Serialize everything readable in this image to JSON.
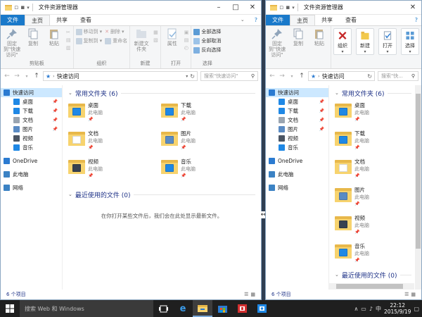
{
  "left": {
    "title": "文件资源管理器",
    "tabs": [
      "文件",
      "主页",
      "共享",
      "查看"
    ],
    "ribbon": {
      "clipboard": {
        "label": "剪贴板",
        "pin": "固定到\"快速访问\"",
        "copy": "复制",
        "paste": "粘贴"
      },
      "organize": {
        "label": "组织",
        "move": "移动到",
        "copy_to": "复制到",
        "delete": "删除",
        "rename": "重命名"
      },
      "new": {
        "label": "新建",
        "folder": "新建文件夹"
      },
      "open": {
        "label": "打开",
        "properties": "属性"
      },
      "select": {
        "label": "选择",
        "all": "全部选择",
        "none": "全部取消",
        "invert": "反向选择"
      }
    },
    "address": "快速访问",
    "search_placeholder": "搜索\"快速访问\"",
    "status": "6 个项目"
  },
  "right": {
    "title": "文件资源管理器",
    "tabs": [
      "文件",
      "主页",
      "共享",
      "查看"
    ],
    "ribbon": {
      "pin": "固定到\"快速访问\"",
      "copy": "复制",
      "paste": "粘贴",
      "organize": "组织",
      "new": "新建",
      "open": "打开",
      "select": "选择"
    },
    "address": "快速访问",
    "search_placeholder": "搜索\"快...",
    "status": "6 个项目"
  },
  "sidebar": [
    {
      "label": "快速访问",
      "icon": "star-icon",
      "color": "#2b7bd1",
      "selected": true
    },
    {
      "label": "桌面",
      "icon": "desktop-icon",
      "color": "#1f88e5",
      "sub": true,
      "pin": true
    },
    {
      "label": "下载",
      "icon": "download-icon",
      "color": "#1f88e5",
      "sub": true,
      "pin": true
    },
    {
      "label": "文档",
      "icon": "document-icon",
      "color": "#9aa5b1",
      "sub": true,
      "pin": true
    },
    {
      "label": "图片",
      "icon": "picture-icon",
      "color": "#5a8bc4",
      "sub": true,
      "pin": true
    },
    {
      "label": "视频",
      "icon": "video-icon",
      "color": "#4b5563",
      "sub": true
    },
    {
      "label": "音乐",
      "icon": "music-icon",
      "color": "#1f88e5",
      "sub": true
    },
    {
      "label": "OneDrive",
      "icon": "onedrive-icon",
      "color": "#2b7bd1",
      "gap": true
    },
    {
      "label": "此电脑",
      "icon": "pc-icon",
      "color": "#3b82c4",
      "gap": true
    },
    {
      "label": "网络",
      "icon": "network-icon",
      "color": "#3b82c4",
      "gap": true
    }
  ],
  "frequent": {
    "heading": "常用文件夹 (6)",
    "items": [
      {
        "name": "桌面",
        "sub": "此电脑",
        "icon": "desktop-folder-icon",
        "badge": "#1f88e5"
      },
      {
        "name": "下载",
        "sub": "此电脑",
        "icon": "download-folder-icon",
        "badge": "#1f88e5"
      },
      {
        "name": "文档",
        "sub": "此电脑",
        "icon": "document-folder-icon",
        "badge": "#ffffff"
      },
      {
        "name": "图片",
        "sub": "此电脑",
        "icon": "picture-folder-icon",
        "badge": "#5a8bc4"
      },
      {
        "name": "视频",
        "sub": "此电脑",
        "icon": "video-folder-icon",
        "badge": "#374151"
      },
      {
        "name": "音乐",
        "sub": "此电脑",
        "icon": "music-folder-icon",
        "badge": "#1f88e5"
      }
    ]
  },
  "recent": {
    "heading": "最近使用的文件 (0)",
    "empty_text": "在你打开某些文件后，我们会在此处显示最新文件。"
  },
  "taskbar": {
    "search_placeholder": "搜索 Web 和 Windows",
    "time": "22:12",
    "date": "2015/9/19"
  }
}
